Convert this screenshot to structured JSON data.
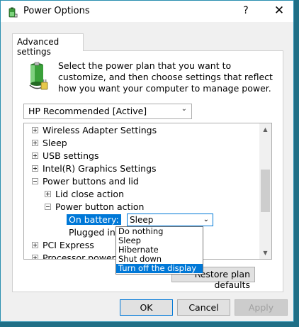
{
  "window": {
    "title": "Power Options",
    "help_glyph": "?",
    "close_glyph": "✕"
  },
  "tabs": [
    {
      "label": "Advanced settings"
    }
  ],
  "description": "Select the power plan that you want to customize, and then choose settings that reflect how you want your computer to manage power.",
  "plan_select": {
    "value": "HP Recommended [Active]"
  },
  "tree": {
    "items": [
      {
        "label": "Wireless Adapter Settings",
        "expander": "plus"
      },
      {
        "label": "Sleep",
        "expander": "plus"
      },
      {
        "label": "USB settings",
        "expander": "plus"
      },
      {
        "label": "Intel(R) Graphics Settings",
        "expander": "plus"
      },
      {
        "label": "Power buttons and lid",
        "expander": "minus"
      },
      {
        "label": "Lid close action",
        "expander": "plus"
      },
      {
        "label": "Power button action",
        "expander": "minus"
      },
      {
        "label": "On battery:"
      },
      {
        "label": "Plugged in:"
      },
      {
        "label": "PCI Express",
        "expander": "plus"
      },
      {
        "label": "Processor power m",
        "expander": "plus"
      }
    ],
    "setting_value": "Sleep"
  },
  "dropdown": {
    "options": [
      "Do nothing",
      "Sleep",
      "Hibernate",
      "Shut down",
      "Turn off the display"
    ],
    "selected": "Turn off the display"
  },
  "restore_button": "Restore plan defaults",
  "buttons": {
    "ok": "OK",
    "cancel": "Cancel",
    "apply": "Apply"
  },
  "colors": {
    "accent": "#0078d7",
    "desktop": "#1f6f86"
  }
}
